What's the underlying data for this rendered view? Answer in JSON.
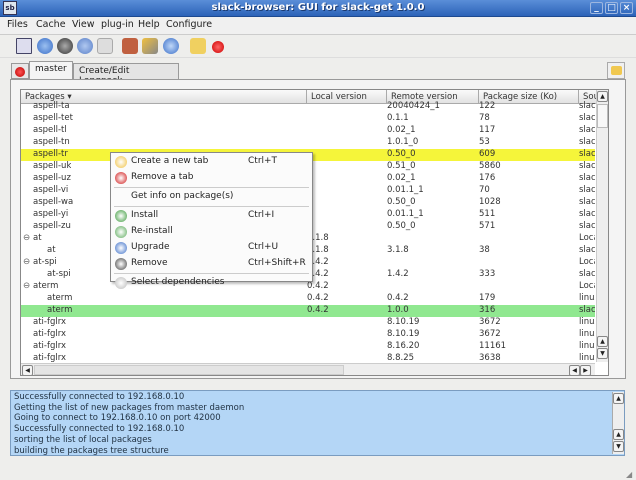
{
  "window": {
    "title": "slack-browser: GUI for slack-get 1.0.0",
    "app_icon": "sb",
    "controls": [
      "_",
      "□",
      "×"
    ]
  },
  "menubar": [
    "Files",
    "Cache",
    "View",
    "plug-in",
    "Help",
    "Configure"
  ],
  "toolbar": {
    "icons": [
      "new-tab-icon",
      "upgrade-icon",
      "remove-icon",
      "reload-icon",
      "dependencies-icon",
      "info-icon",
      "configure-icon",
      "help-icon",
      "create-tab-icon",
      "remove-tab-icon"
    ]
  },
  "tabs": [
    {
      "label": "master",
      "active": true
    },
    {
      "label": "Create/Edit Langpack",
      "active": false
    }
  ],
  "table": {
    "columns": [
      "Packages",
      "Local version",
      "Remote version",
      "Package size (Ko)",
      "Source"
    ],
    "rows": [
      {
        "name": "aspell-ta",
        "indent": 1,
        "local": "",
        "remote": "20040424_1",
        "size": "122",
        "source": "slackw"
      },
      {
        "name": "aspell-tet",
        "indent": 1,
        "local": "",
        "remote": "0.1.1",
        "size": "78",
        "source": "slackw"
      },
      {
        "name": "aspell-tl",
        "indent": 1,
        "local": "",
        "remote": "0.02_1",
        "size": "117",
        "source": "slackw"
      },
      {
        "name": "aspell-tn",
        "indent": 1,
        "local": "",
        "remote": "1.0.1_0",
        "size": "53",
        "source": "slackw"
      },
      {
        "name": "aspell-tr",
        "indent": 1,
        "local": "",
        "remote": "0.50_0",
        "size": "609",
        "source": "slackw",
        "highlight": "yellow"
      },
      {
        "name": "aspell-uk",
        "indent": 1,
        "local": "",
        "remote": "0.51_0",
        "size": "5860",
        "source": "slackw"
      },
      {
        "name": "aspell-uz",
        "indent": 1,
        "local": "",
        "remote": "0.02_1",
        "size": "176",
        "source": "slackw"
      },
      {
        "name": "aspell-vi",
        "indent": 1,
        "local": "",
        "remote": "0.01.1_1",
        "size": "70",
        "source": "slackw"
      },
      {
        "name": "aspell-wa",
        "indent": 1,
        "local": "",
        "remote": "0.50_0",
        "size": "1028",
        "source": "slackw"
      },
      {
        "name": "aspell-yi",
        "indent": 1,
        "local": "",
        "remote": "0.01.1_1",
        "size": "511",
        "source": "slackw"
      },
      {
        "name": "aspell-zu",
        "indent": 1,
        "local": "",
        "remote": "0.50_0",
        "size": "571",
        "source": "slackw"
      },
      {
        "name": "at",
        "indent": 0,
        "expander": "⊖",
        "local": "3.1.8",
        "remote": "",
        "size": "",
        "source": "Local r"
      },
      {
        "name": "at",
        "indent": 2,
        "local": "3.1.8",
        "remote": "3.1.8",
        "size": "38",
        "source": "slackw"
      },
      {
        "name": "at-spi",
        "indent": 0,
        "expander": "⊖",
        "local": "0.4.2",
        "remote": "",
        "size": "",
        "source": "Local r"
      },
      {
        "name": "at-spi",
        "indent": 2,
        "local": "0.4.2",
        "remote": "1.4.2",
        "size": "333",
        "source": "slackw"
      },
      {
        "name": "aterm",
        "indent": 0,
        "expander": "⊖",
        "local": "0.4.2",
        "remote": "",
        "size": "",
        "source": "Local r"
      },
      {
        "name": "aterm",
        "indent": 2,
        "local": "0.4.2",
        "remote": "0.4.2",
        "size": "179",
        "source": "linuxpa"
      },
      {
        "name": "aterm",
        "indent": 2,
        "local": "0.4.2",
        "remote": "1.0.0",
        "size": "316",
        "source": "slacky",
        "highlight": "green"
      },
      {
        "name": "ati-fglrx",
        "indent": 1,
        "local": "",
        "remote": "8.10.19",
        "size": "3672",
        "source": "linuxpa"
      },
      {
        "name": "ati-fglrx",
        "indent": 1,
        "local": "",
        "remote": "8.10.19",
        "size": "3672",
        "source": "linuxpa"
      },
      {
        "name": "ati-fglrx",
        "indent": 1,
        "local": "",
        "remote": "8.16.20",
        "size": "11161",
        "source": "linuxpa"
      },
      {
        "name": "ati-fglrx",
        "indent": 1,
        "local": "",
        "remote": "8.8.25",
        "size": "3638",
        "source": "linuxpa"
      }
    ]
  },
  "context_menu": {
    "items": [
      {
        "label": "Create a new tab",
        "shortcut": "Ctrl+T",
        "icon": "create-tab-icon",
        "color": "#f0c040"
      },
      {
        "label": "Remove a tab",
        "shortcut": "",
        "icon": "remove-tab-icon",
        "color": "#d01818"
      },
      {
        "separator": true
      },
      {
        "label": "Get info on package(s)",
        "shortcut": "",
        "icon": ""
      },
      {
        "separator": true
      },
      {
        "label": "Install",
        "shortcut": "Ctrl+I",
        "icon": "install-icon",
        "color": "#3a9a3a"
      },
      {
        "label": "Re-install",
        "shortcut": "",
        "icon": "reinstall-icon",
        "color": "#5aaa5a"
      },
      {
        "label": "Upgrade",
        "shortcut": "Ctrl+U",
        "icon": "upgrade-icon",
        "color": "#3a6ec8"
      },
      {
        "label": "Remove",
        "shortcut": "Ctrl+Shift+R",
        "icon": "remove-icon",
        "color": "#444444"
      },
      {
        "separator": true
      },
      {
        "label": "Select dependencies",
        "shortcut": "",
        "icon": "dependencies-icon",
        "color": "#bbbbbb"
      }
    ]
  },
  "log": [
    "Successfully connected to 192.168.0.10",
    "Getting the list of new packages from master daemon",
    "Going to connect to 192.168.0.10 on port 42000",
    "Successfully connected to 192.168.0.10",
    "sorting the list of local packages",
    "building the packages tree structure"
  ],
  "colors": {
    "titlebar": "#3a72c8",
    "highlight_yellow": "#f5f53a",
    "highlight_green": "#90e890",
    "log_bg": "#b4d6f6"
  }
}
